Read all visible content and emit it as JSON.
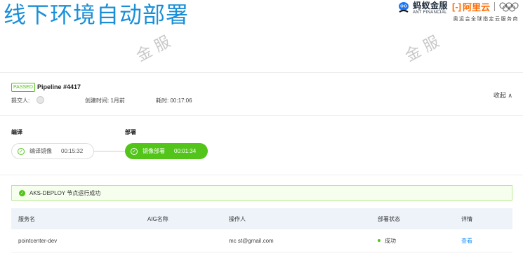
{
  "slide": {
    "title": "线下环境自动部署"
  },
  "logos": {
    "ant_cn": "蚂蚁金服",
    "ant_en": "ANT FINANCIAL",
    "aliyun_name": "阿里云",
    "aliyun_sub": "奥运会全球指定云服务商"
  },
  "watermarks": [
    "金 服",
    "金 服"
  ],
  "pipeline": {
    "status": "PASSED",
    "name": "Pipeline #4417",
    "submitter_label": "提交人:",
    "created_label": "创建时间: 1月前",
    "duration_label": "耗时: 00:17:06",
    "collapse": "收起 ∧"
  },
  "stages": [
    {
      "title": "编译",
      "step": "编译镜像",
      "time": "00:15:32"
    },
    {
      "title": "部署",
      "step": "镜像部署",
      "time": "00:01:34"
    }
  ],
  "alert": {
    "text": "AKS-DEPLOY 节点运行成功"
  },
  "table": {
    "headers": [
      "服务名",
      "AIG名称",
      "操作人",
      "部署状态",
      "详情"
    ],
    "rows": [
      {
        "service": "pointcenter-dev",
        "aig": "",
        "operator": "mc  st@gmail.com",
        "status": "成功",
        "detail": "查看"
      }
    ]
  },
  "colors": {
    "title": "#1a8fd8",
    "success": "#52c41a",
    "link": "#1890ff",
    "aliyun": "#ff6a00"
  }
}
